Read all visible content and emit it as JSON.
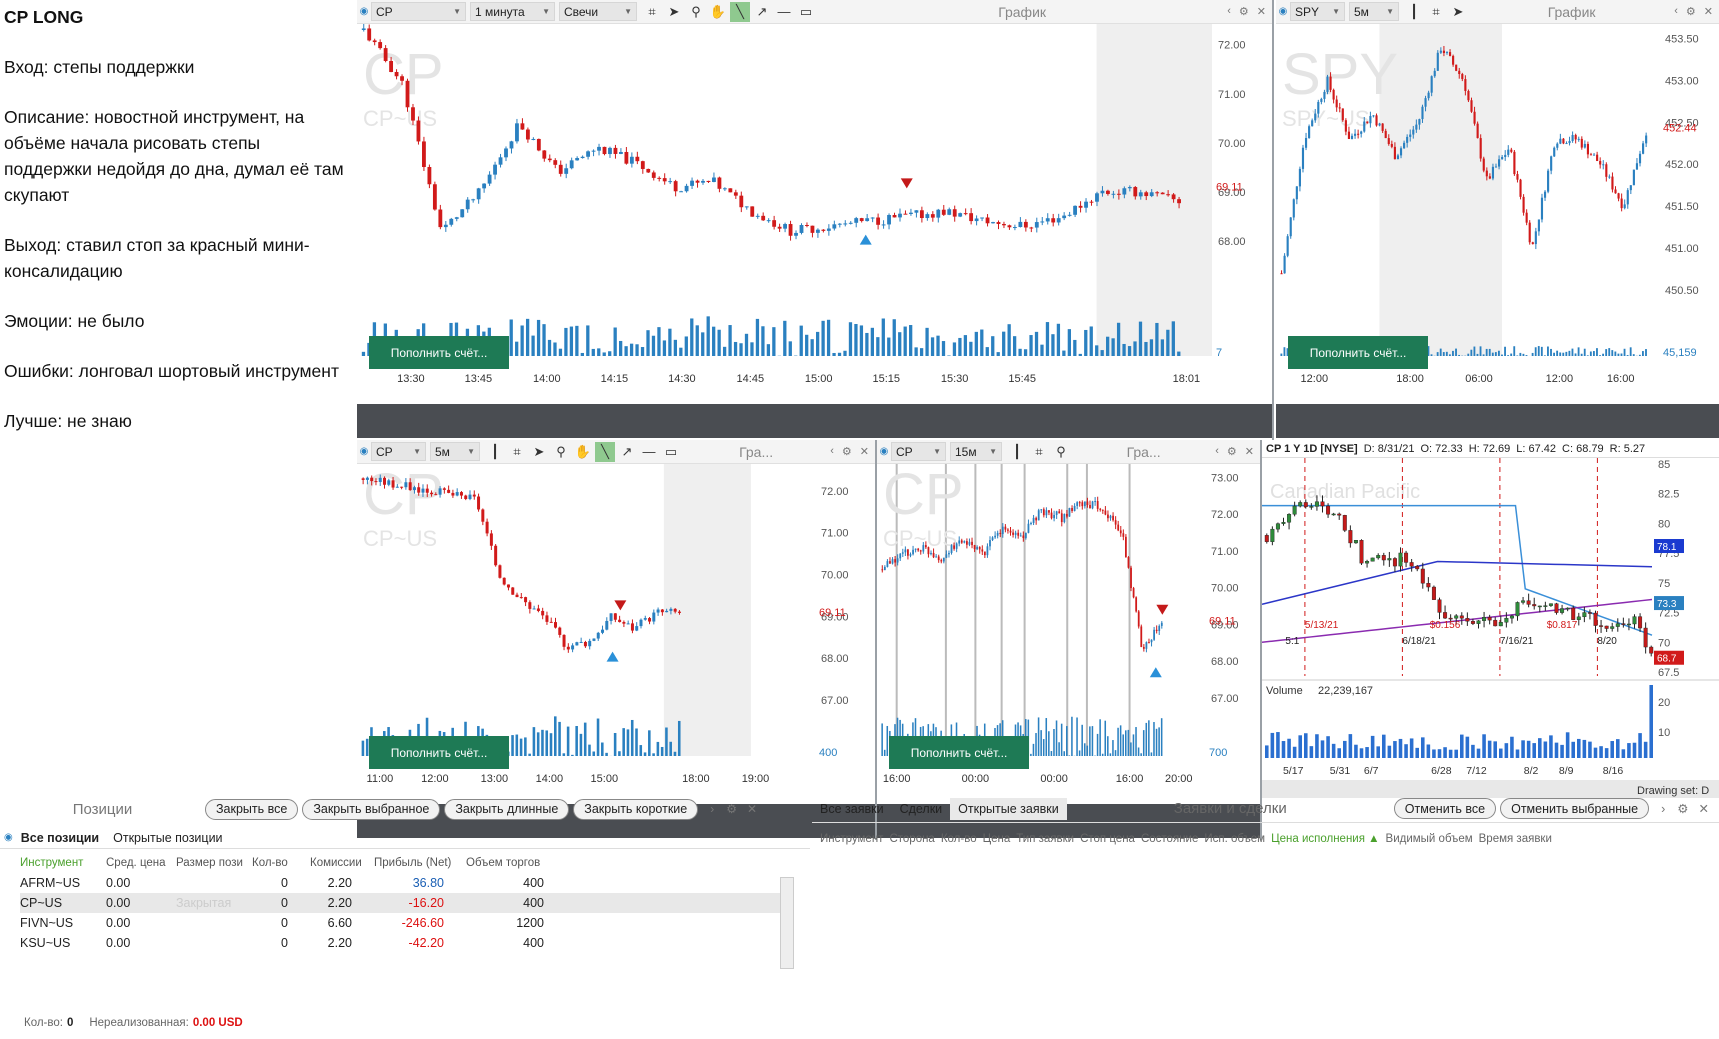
{
  "notes": {
    "title": "CP LONG",
    "lines": [
      "Вход: степы поддержки",
      "Описание: новостной инструмент, на объёме начала рисовать степы поддержки недойдя до дна, думал её там скупают",
      "Выход: ставил стоп за красный мини-консалидацию",
      "Эмоции: не было",
      "Ошибки: лонговал шортовый инструмент",
      "Лучше: не знаю"
    ]
  },
  "chart1": {
    "symbol": "CP",
    "interval": "1 минута",
    "type": "Свечи",
    "title": "График",
    "watermark": "CP",
    "watermark2": "CP~US",
    "yticks": [
      "72.00",
      "71.00",
      "70.00",
      "69.00",
      "68.00"
    ],
    "price_tag": "69.11",
    "xticks": [
      "13:30",
      "13:45",
      "14:00",
      "14:15",
      "14:30",
      "14:45",
      "15:00",
      "15:15",
      "15:30",
      "15:45",
      "18:01"
    ],
    "vol_label": "7",
    "fill_btn": "Пополнить счёт...",
    "chart_data": {
      "type": "candlestick",
      "close": [
        72.3,
        71.2,
        68.2,
        69.0,
        70.4,
        69.4,
        69.9,
        69.6,
        69.1,
        69.2,
        68.6,
        68.2,
        68.3,
        68.4,
        68.5,
        68.6,
        68.4,
        68.3,
        68.5,
        69.0,
        69.0,
        68.8
      ],
      "ylim": [
        67.0,
        72.3
      ]
    }
  },
  "chart2": {
    "symbol": "SPY",
    "interval": "5м",
    "title": "График",
    "watermark": "SPY",
    "watermark2": "SPY~US",
    "yticks": [
      "453.50",
      "453.00",
      "452.50",
      "452.00",
      "451.50",
      "451.00",
      "450.50"
    ],
    "price_tag": "452.44",
    "xticks": [
      "12:00",
      "18:00",
      "06:00",
      "12:00",
      "16:00"
    ],
    "vol_label": "45,159",
    "fill_btn": "Пополнить счёт...",
    "chart_data": {
      "type": "candlestick",
      "close": [
        450.7,
        452.3,
        453.0,
        452.3,
        452.6,
        452.1,
        452.5,
        453.4,
        453.0,
        451.8,
        452.2,
        451.0,
        452.3,
        452.3,
        452.0,
        451.5,
        452.4
      ],
      "ylim": [
        450.5,
        453.6
      ]
    }
  },
  "chart3": {
    "symbol": "CP",
    "interval": "5м",
    "title": "Гра...",
    "watermark": "CP",
    "watermark2": "CP~US",
    "yticks": [
      "72.00",
      "71.00",
      "70.00",
      "69.00",
      "68.00",
      "67.00"
    ],
    "price_tag": "69.11",
    "xticks": [
      "11:00",
      "12:00",
      "13:00",
      "14:00",
      "15:00",
      "18:00",
      "19:00"
    ],
    "vol_label": "400",
    "fill_btn": "Пополнить счёт...",
    "chart_data": {
      "type": "candlestick",
      "close": [
        72.3,
        72.2,
        72.1,
        72.0,
        71.9,
        71.8,
        70.0,
        69.4,
        69.0,
        68.3,
        68.4,
        69.0,
        68.7,
        69.1,
        69.1
      ],
      "ylim": [
        67.0,
        72.5
      ]
    }
  },
  "chart4": {
    "symbol": "CP",
    "interval": "15м",
    "title": "Гра...",
    "watermark": "CP",
    "watermark2": "CP~US",
    "yticks": [
      "73.00",
      "72.00",
      "71.00",
      "70.00",
      "69.00",
      "68.00",
      "67.00"
    ],
    "price_tag": "69.11",
    "xticks": [
      "16:00",
      "00:00",
      "00:00",
      "16:00",
      "20:00"
    ],
    "vol_label": "700",
    "fill_btn": "Пополнить счёт...",
    "chart_data": {
      "type": "candlestick",
      "close": [
        70.5,
        70.9,
        71.1,
        70.8,
        71.3,
        70.9,
        71.6,
        71.4,
        72.1,
        71.9,
        72.3,
        72.2,
        71.5,
        68.4,
        69.0
      ],
      "ylim": [
        67.0,
        73.2
      ]
    }
  },
  "chart5": {
    "header": "CP 1 Y 1D [NYSE]",
    "d": "D: 8/31/21",
    "o": "O: 72.33",
    "h": "H: 72.69",
    "l": "L: 67.42",
    "c": "C: 68.79",
    "r": "R: 5.27",
    "watermark": "Canadian Pacific",
    "yticks": [
      "85",
      "82.5",
      "80",
      "77.5",
      "75",
      "72.5",
      "70",
      "67.5"
    ],
    "tags": [
      "78.1",
      "73.3",
      "68.7"
    ],
    "events": [
      "5:1",
      "5/13/21",
      "6/18/21",
      "$0.156",
      "7/16/21",
      "$0.817",
      "8/20"
    ],
    "volume_label": "Volume",
    "volume_value": "22,239,167",
    "vticks": [
      "20",
      "10"
    ],
    "xticks": [
      "5/17",
      "5/31",
      "6/7",
      "6/28",
      "7/12",
      "8/2",
      "8/9",
      "8/16"
    ],
    "drawing": "Drawing set: D",
    "chart_data": {
      "type": "candlestick",
      "close": [
        79,
        80,
        82,
        81,
        80,
        77,
        77,
        77,
        76,
        72,
        72,
        72,
        71,
        73,
        73,
        73,
        72,
        72,
        71,
        72,
        69
      ],
      "ylim": [
        67.5,
        85
      ]
    }
  },
  "positions": {
    "title": "Позиции",
    "buttons": [
      "Закрыть все",
      "Закрыть выбранное",
      "Закрыть длинные",
      "Закрыть короткие"
    ],
    "tabs": [
      "Все позиции",
      "Открытые позиции"
    ],
    "columns": [
      "Инструмент",
      "Сред. цена",
      "Размер пози",
      "Кол-во",
      "Комиссии",
      "Прибыль (Net)",
      "Объем торгов"
    ],
    "rows": [
      {
        "sym": "AFRM~US",
        "avg": "0.00",
        "size": "",
        "qty": "0",
        "comm": "2.20",
        "pnl": "36.80",
        "vol": "400",
        "sign": "pos"
      },
      {
        "sym": "CP~US",
        "avg": "0.00",
        "size": "Закрытая",
        "qty": "0",
        "comm": "2.20",
        "pnl": "-16.20",
        "vol": "400",
        "sign": "neg"
      },
      {
        "sym": "FIVN~US",
        "avg": "0.00",
        "size": "",
        "qty": "0",
        "comm": "6.60",
        "pnl": "-246.60",
        "vol": "1200",
        "sign": "neg"
      },
      {
        "sym": "KSU~US",
        "avg": "0.00",
        "size": "",
        "qty": "0",
        "comm": "2.20",
        "pnl": "-42.20",
        "vol": "400",
        "sign": "neg"
      }
    ],
    "footer_qty_label": "Кол-во:",
    "footer_qty": "0",
    "footer_unreal_label": "Нереализованная:",
    "footer_unreal": "0.00 USD"
  },
  "orders": {
    "tabs": [
      "Все заявки",
      "Сделки",
      "Открытые заявки"
    ],
    "title": "Заявки и сделки",
    "buttons": [
      "Отменить все",
      "Отменить выбранные"
    ],
    "columns": [
      "Инструмент",
      "Сторона",
      "Кол-во",
      "Цена",
      "Тип заявки",
      "Стоп цена",
      "Состояние",
      "Исп. объем",
      "Цена исполнения",
      "Видимый объем",
      "Время заявки"
    ]
  },
  "colors": {
    "up": "#2a80c0",
    "down": "#d11a1a",
    "fill_btn": "#1e7a55",
    "active_col": "#4aa02c"
  }
}
